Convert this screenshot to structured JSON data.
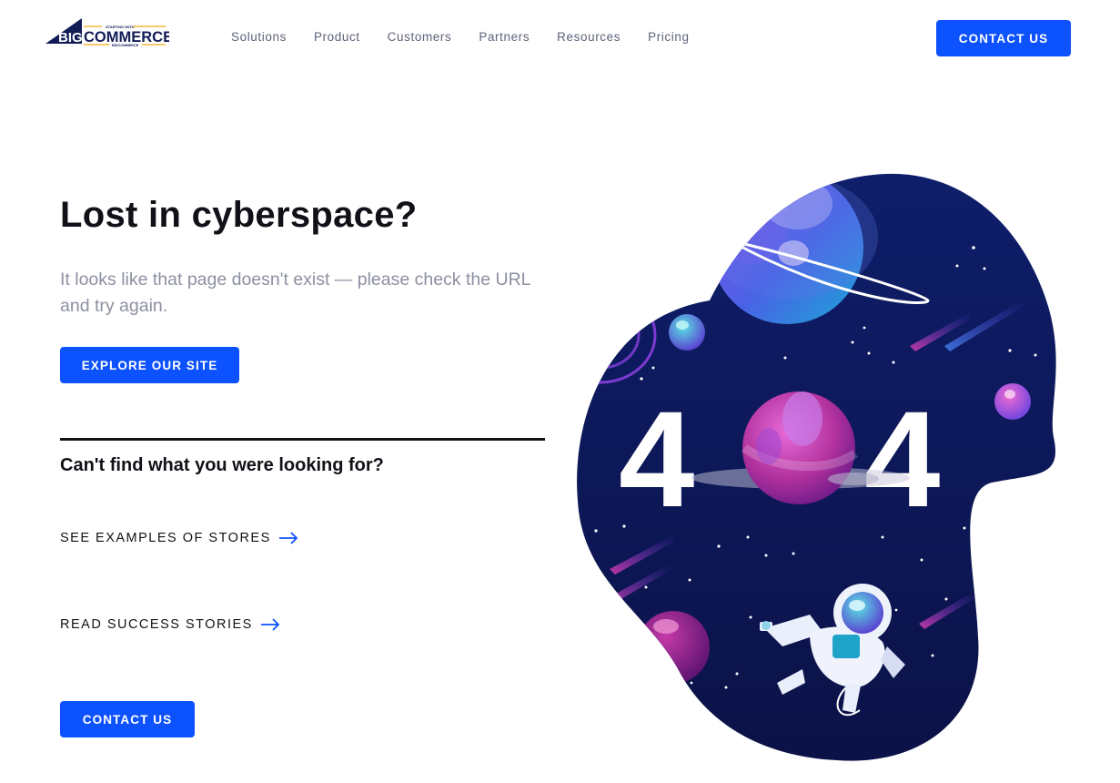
{
  "header": {
    "logo": {
      "text_big": "BIG",
      "text_commerce": "COMMERCE",
      "tagline_top": "STARTING WITH",
      "tagline_bottom": "BIGCOMMERCE"
    },
    "nav": [
      {
        "label": "Solutions"
      },
      {
        "label": "Product"
      },
      {
        "label": "Customers"
      },
      {
        "label": "Partners"
      },
      {
        "label": "Resources"
      },
      {
        "label": "Pricing"
      }
    ],
    "contact_label": "CONTACT US"
  },
  "main": {
    "title": "Lost in cyberspace?",
    "subtitle": "It looks like that page doesn't exist — please check the URL and try again.",
    "explore_label": "EXPLORE OUR SITE",
    "cant_find": "Can't find what you were looking for?",
    "links": [
      {
        "label": "SEE EXAMPLES OF STORES"
      },
      {
        "label": "READ SUCCESS STORIES"
      }
    ],
    "contact_label": "CONTACT US"
  },
  "illustration": {
    "error_code": "404",
    "digit_left": "4",
    "digit_right": "4"
  },
  "colors": {
    "accent": "#0d52ff",
    "text_dark": "#121118",
    "text_muted": "#8c90a1",
    "nav_text": "#5e637a",
    "space_bg": "#0e1a5e"
  },
  "icons": [
    "bigcommerce-logo",
    "arrow-right-icon",
    "planet-icon",
    "astronaut-icon",
    "comet-icon",
    "star-icon"
  ]
}
